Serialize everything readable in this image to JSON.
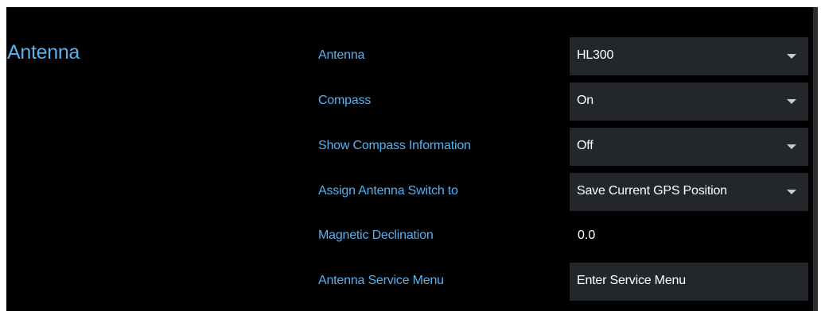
{
  "section": {
    "title": "Antenna"
  },
  "settings": [
    {
      "label": "Antenna",
      "value": "HL300",
      "kind": "dropdown"
    },
    {
      "label": "Compass",
      "value": "On",
      "kind": "dropdown"
    },
    {
      "label": "Show Compass Information",
      "value": "Off",
      "kind": "dropdown"
    },
    {
      "label": "Assign Antenna Switch to",
      "value": "Save Current GPS Position",
      "kind": "dropdown"
    },
    {
      "label": "Magnetic Declination",
      "value": "0.0",
      "kind": "value"
    },
    {
      "label": "Antenna Service Menu",
      "value": "Enter Service Menu",
      "kind": "button"
    }
  ],
  "colors": {
    "background": "#000000",
    "label": "#58b0f0",
    "control_bg": "#23272c",
    "text": "#ffffff",
    "scrollbar": "#2b2d30"
  },
  "icons": {
    "dropdown": "chevron-down-icon"
  }
}
